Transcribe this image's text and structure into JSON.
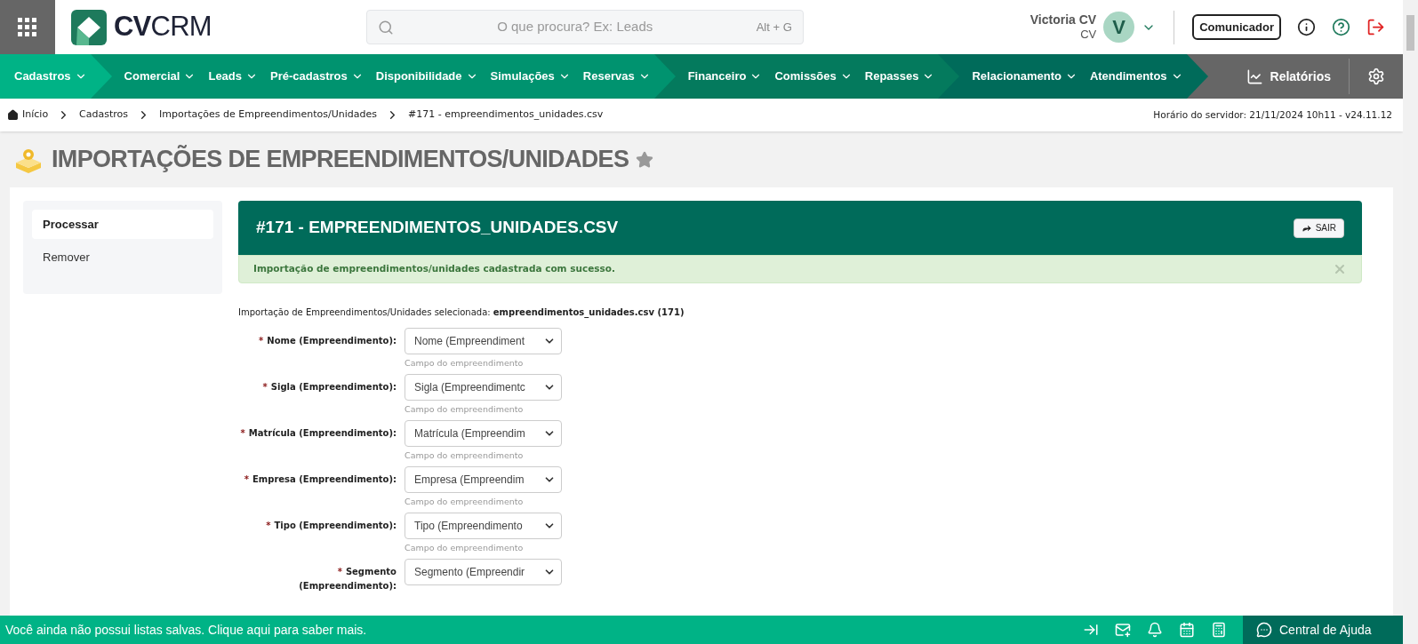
{
  "header": {
    "logo": "**CV**CRM",
    "search": {
      "placeholder": "O que procura? Ex: Leads",
      "shortcut": "Alt + G"
    },
    "user": {
      "name": "Victoria CV",
      "role": "CV",
      "initial": "V"
    },
    "communicator_button": "Comunicador"
  },
  "nav": {
    "groups": [
      {
        "color": "#00b386",
        "items": [
          "Cadastros"
        ]
      },
      {
        "color": "#00936f",
        "items": [
          "Comercial",
          "Leads",
          "Pré-cadastros",
          "Disponibilidade",
          "Simulações",
          "Reservas"
        ]
      },
      {
        "color": "#047a5d",
        "items": [
          "Financeiro",
          "Comissões",
          "Repasses"
        ]
      },
      {
        "color": "#006b5a",
        "items": [
          "Relacionamento",
          "Atendimentos"
        ]
      }
    ],
    "reports": "Relatórios"
  },
  "breadcrumb": {
    "items": [
      "Início",
      "Cadastros",
      "Importações de Empreendimentos/Unidades",
      "#171 - empreendimentos_unidades.csv"
    ],
    "server_time": "Horário do servidor: 21/11/2024 10h11 - v24.11.12"
  },
  "page": {
    "title": "IMPORTAÇÕES DE EMPREENDIMENTOS/UNIDADES",
    "favorite": false
  },
  "sidebar": {
    "items": [
      {
        "label": "Processar",
        "selected": true
      },
      {
        "label": "Remover",
        "selected": false
      }
    ]
  },
  "panel": {
    "title": "#171 - EMPREENDIMENTOS_UNIDADES.CSV",
    "exit_button": "SAIR",
    "alert": "Importação de empreendimentos/unidades cadastrada com sucesso.",
    "selected_file": "Importação de Empreendimentos/Unidades selecionada: **empreendimentos_unidades.csv (171)**",
    "fields": [
      {
        "required": true,
        "mark": "*",
        "label": "Nome (Empreendimento):",
        "value": "Nome (Empreendiment",
        "hint": "Campo do empreendimento"
      },
      {
        "required": true,
        "mark": "*",
        "label": "Sigla (Empreendimento):",
        "value": "Sigla (Empreendimentc",
        "hint": "Campo do empreendimento"
      },
      {
        "required": true,
        "mark": "*",
        "label": "Matrícula (Empreendimento):",
        "value": "Matrícula (Empreendim",
        "hint": "Campo do empreendimento"
      },
      {
        "required": true,
        "mark": "*",
        "label": "Empresa (Empreendimento):",
        "value": "Empresa (Empreendim",
        "hint": "Campo do empreendimento"
      },
      {
        "required": true,
        "mark": "*",
        "label": "Tipo (Empreendimento):",
        "value": "Tipo (Empreendimento",
        "hint": "Campo do empreendimento"
      },
      {
        "required": true,
        "mark": "*",
        "label": "Segmento (Empreendimento):",
        "value": "Segmento (Empreendir"
      }
    ]
  },
  "footer": {
    "message": "Você ainda não possui listas salvas. Clique aqui para saber mais.",
    "help": "Central de Ajuda"
  }
}
